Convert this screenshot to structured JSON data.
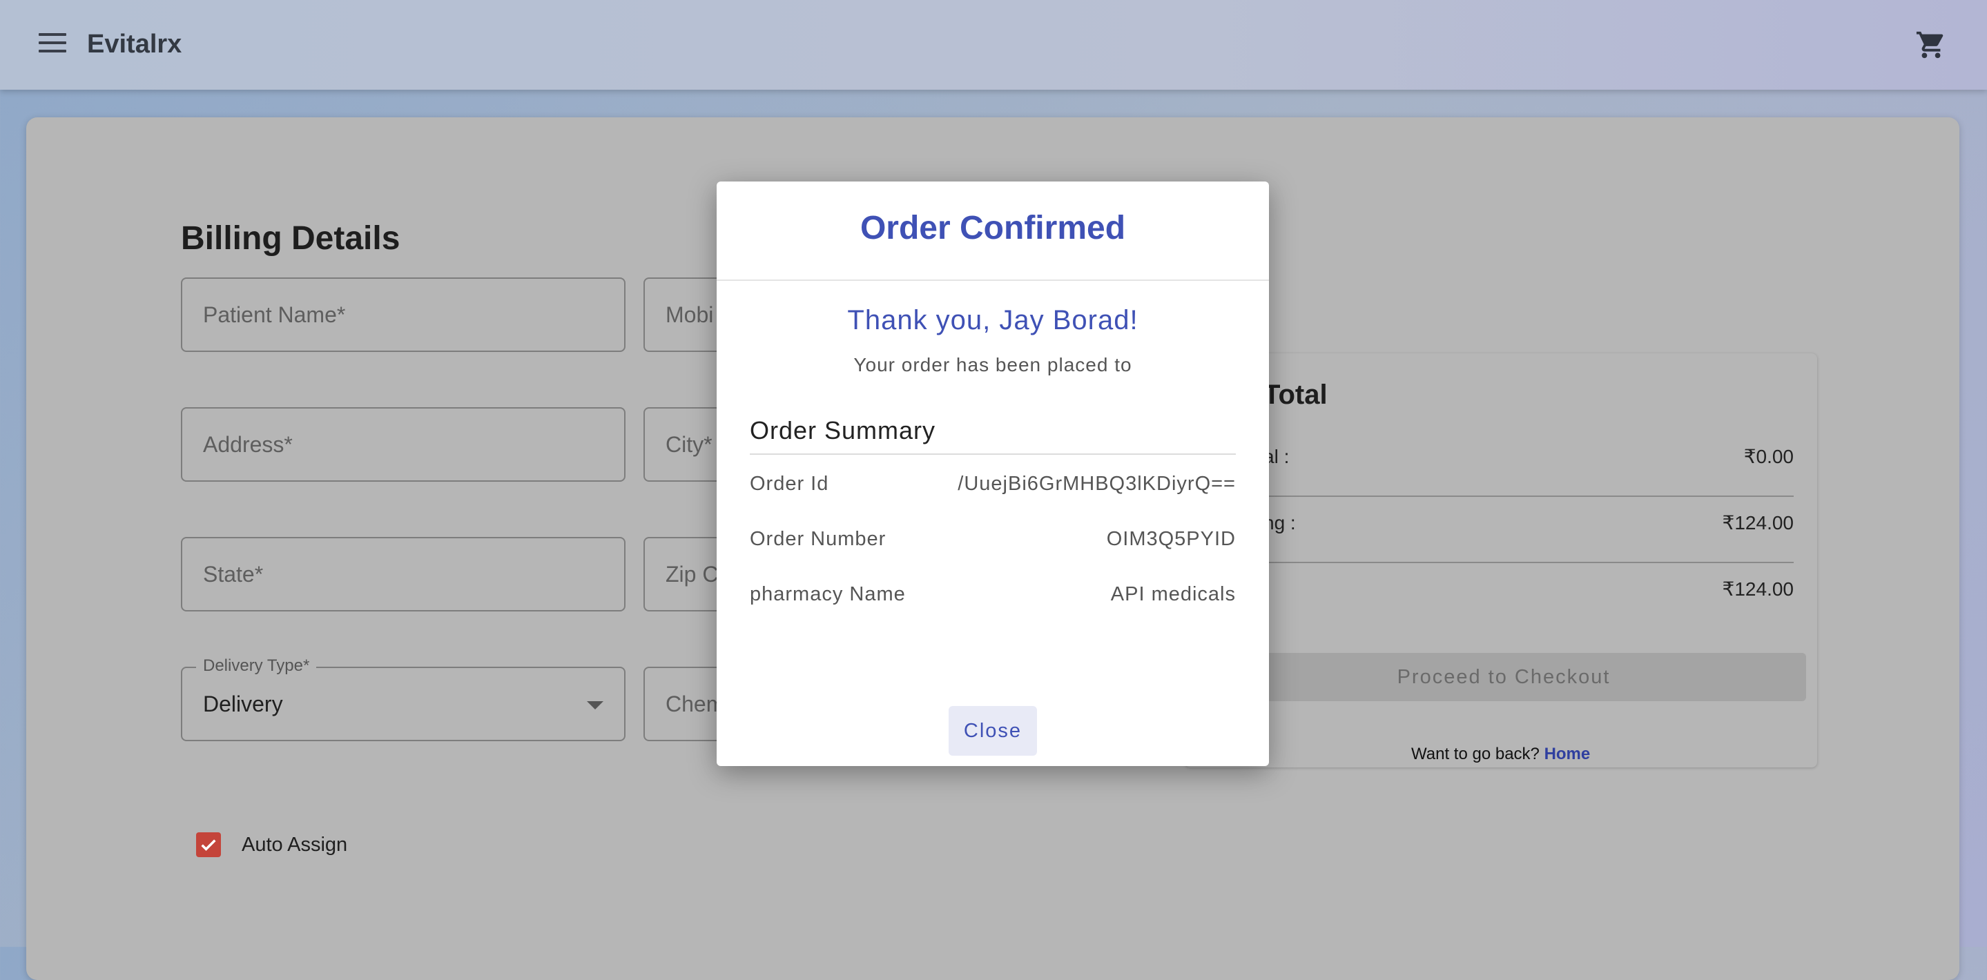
{
  "appbar": {
    "title": "Evitalrx",
    "menu_icon": "menu-icon",
    "cart_icon": "cart-icon"
  },
  "billing": {
    "title": "Billing Details",
    "fields": {
      "patient_name": "Patient Name*",
      "mobile": "Mobi",
      "address": "Address*",
      "city": "City*",
      "state": "State*",
      "zip": "Zip C",
      "delivery_type_label": "Delivery Type*",
      "delivery_type_value": "Delivery",
      "chemist": "Chem"
    },
    "auto_assign_label": "Auto Assign",
    "auto_assign_checked": true
  },
  "cart": {
    "title": "Total",
    "rows": [
      {
        "label": "al :",
        "value": "₹0.00"
      },
      {
        "label": "ng :",
        "value": "₹124.00"
      },
      {
        "label": "",
        "value": "₹124.00"
      }
    ],
    "checkout_label": "Proceed to Checkout",
    "go_back_text": "Want to go back?",
    "home_link": "Home"
  },
  "dialog": {
    "title": "Order Confirmed",
    "thanks": "Thank you, Jay Borad!",
    "subtitle": "Your order has been placed to",
    "summary_title": "Order Summary",
    "rows": [
      {
        "label": "Order Id",
        "value": "/UuejBi6GrMHBQ3lKDiyrQ=="
      },
      {
        "label": "Order Number",
        "value": "OIM3Q5PYID"
      },
      {
        "label": "pharmacy Name",
        "value": "API medicals"
      }
    ],
    "close_label": "Close",
    "accent_color": "#3f51b5"
  }
}
